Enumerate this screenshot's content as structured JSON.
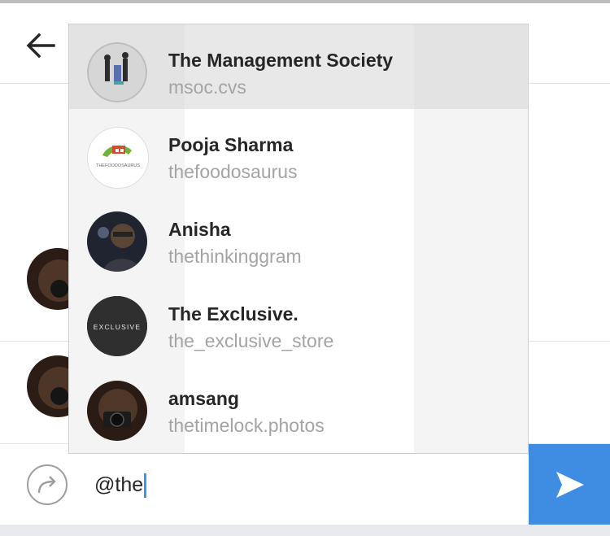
{
  "composer": {
    "input_value": "@the"
  },
  "suggestions": [
    {
      "name": "The Management Society",
      "handle": "msoc.cvs",
      "avatar": "management-society-logo"
    },
    {
      "name": "Pooja Sharma",
      "handle": "thefoodosaurus",
      "avatar": "thefoodosaurus-logo",
      "avatar_text": "THEFOODOSAURUS"
    },
    {
      "name": "Anisha",
      "handle": "thethinkinggram",
      "avatar": "portrait-photo"
    },
    {
      "name": "The Exclusive.",
      "handle": "the_exclusive_store",
      "avatar": "exclusive-logo",
      "avatar_text": "EXCLUSIVE"
    },
    {
      "name": "amsang",
      "handle": "thetimelock.photos",
      "avatar": "camera-portrait-photo"
    }
  ],
  "colors": {
    "send_button": "#3f8de3",
    "caret": "#3897f0",
    "handle_text": "#a4a4a4"
  }
}
